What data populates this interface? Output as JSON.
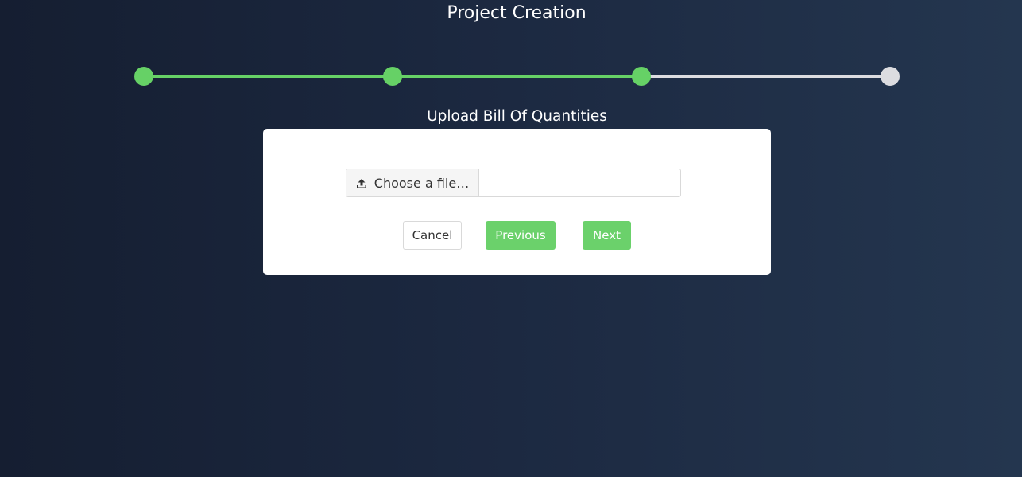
{
  "page": {
    "title": "Project Creation"
  },
  "stepper": {
    "total_steps": 4,
    "current_step": 3,
    "colors": {
      "complete": "#66d166",
      "incomplete": "#dcdce0"
    }
  },
  "section": {
    "title": "Upload Bill Of Quantities"
  },
  "upload": {
    "button_label": "Choose a file…",
    "icon": "upload-icon",
    "file_name": ""
  },
  "actions": {
    "cancel_label": "Cancel",
    "previous_label": "Previous",
    "next_label": "Next",
    "accent_color": "#6bd16b"
  }
}
